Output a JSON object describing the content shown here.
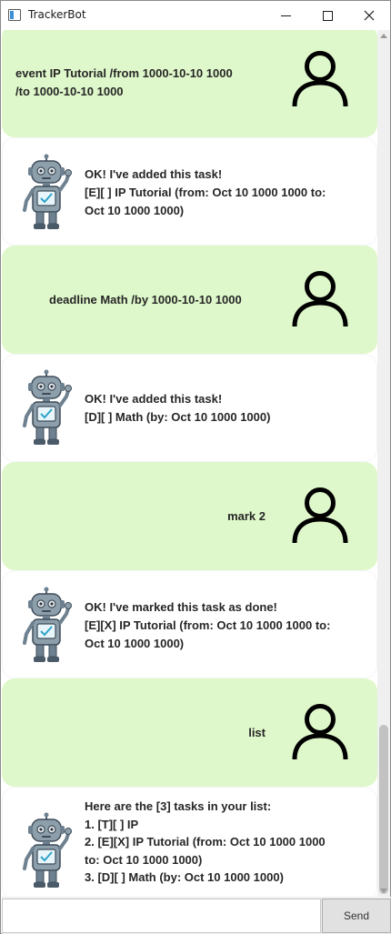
{
  "window": {
    "title": "TrackerBot"
  },
  "colors": {
    "user_bubble": "#dff8cb",
    "bot_bubble": "#ffffff"
  },
  "icons": {
    "user": "person-outline-icon",
    "bot": "robot-icon"
  },
  "messages": [
    {
      "sender": "user",
      "text": "event IP Tutorial /from 1000-10-10 1000\n/to 1000-10-10 1000"
    },
    {
      "sender": "bot",
      "text": "OK! I've added this task!\n [E][ ] IP Tutorial (from: Oct 10 1000 1000 to:\nOct 10 1000 1000)"
    },
    {
      "sender": "user",
      "text": "deadline Math /by 1000-10-10 1000"
    },
    {
      "sender": "bot",
      "text": "OK! I've added this task!\n [D][ ] Math (by: Oct 10 1000 1000)"
    },
    {
      "sender": "user",
      "text": "mark 2"
    },
    {
      "sender": "bot",
      "text": "OK! I've marked this task as done!\n [E][X] IP Tutorial (from: Oct 10 1000 1000 to:\nOct 10 1000 1000)"
    },
    {
      "sender": "user",
      "text": "list"
    },
    {
      "sender": "bot",
      "text": "Here are the [3] tasks in your list:\n1. [T][ ] IP\n2. [E][X] IP Tutorial (from: Oct 10 1000 1000\nto: Oct 10 1000 1000)\n3. [D][ ] Math (by: Oct 10 1000 1000)"
    }
  ],
  "input": {
    "value": "",
    "placeholder": ""
  },
  "send_button": {
    "label": "Send"
  }
}
